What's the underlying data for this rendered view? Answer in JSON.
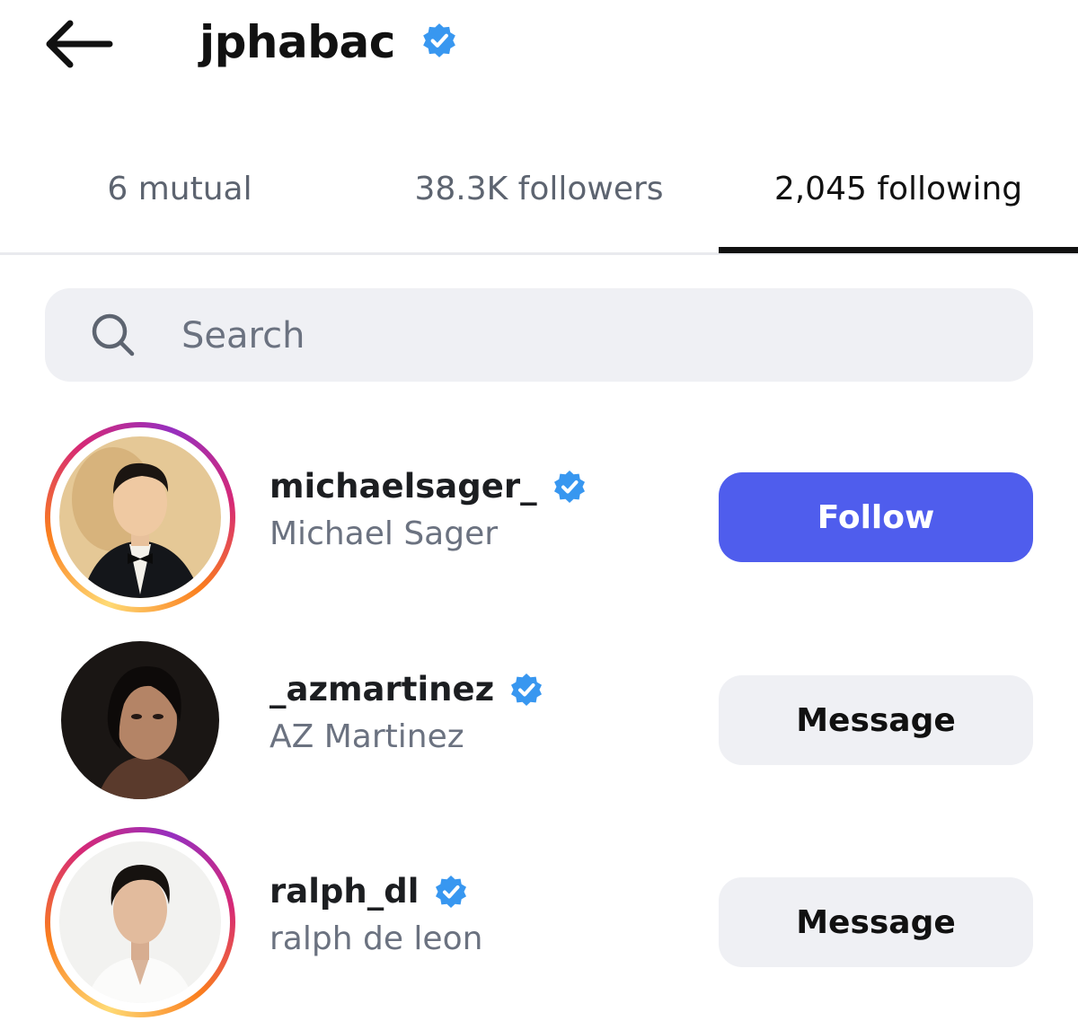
{
  "header": {
    "back_icon": "arrow-left-icon",
    "username": "jphabac",
    "verified_icon": "verified-badge-icon"
  },
  "tabs": [
    {
      "label": "6 mutual",
      "active": false
    },
    {
      "label": "38.3K followers",
      "active": false
    },
    {
      "label": "2,045 following",
      "active": true
    }
  ],
  "search": {
    "placeholder": "Search",
    "value": "",
    "icon": "search-icon"
  },
  "accounts": [
    {
      "username": "michaelsager_",
      "full_name": "Michael Sager",
      "verified": true,
      "story_ring": true,
      "action": "Follow"
    },
    {
      "username": "_azmartinez",
      "full_name": "AZ Martinez",
      "verified": true,
      "story_ring": false,
      "action": "Message"
    },
    {
      "username": "ralph_dl",
      "full_name": "ralph de leon",
      "verified": true,
      "story_ring": true,
      "action": "Message"
    }
  ],
  "colors": {
    "follow_button": "#4f5ded",
    "verified_badge": "#3897f0",
    "secondary_button": "#eff0f4"
  }
}
